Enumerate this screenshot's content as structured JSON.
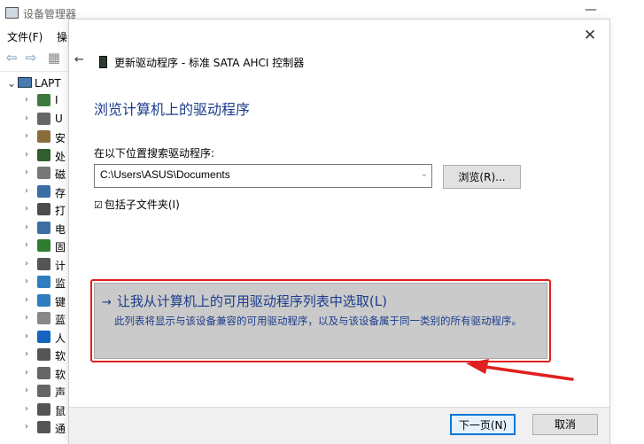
{
  "device_manager": {
    "title": "设备管理器",
    "menu": [
      "文件(F)",
      "操"
    ],
    "tree_root": "LAPT",
    "tree_items": [
      {
        "label": "I",
        "color": "#3d7a3d"
      },
      {
        "label": "U",
        "color": "#666666"
      },
      {
        "label": "安",
        "color": "#8a6d3b"
      },
      {
        "label": "处",
        "color": "#2f5f2f"
      },
      {
        "label": "磁",
        "color": "#777777"
      },
      {
        "label": "存",
        "color": "#3a6ea5"
      },
      {
        "label": "打",
        "color": "#4d4d4d"
      },
      {
        "label": "电",
        "color": "#3a6ea5"
      },
      {
        "label": "固",
        "color": "#2e7d32"
      },
      {
        "label": "计",
        "color": "#555555"
      },
      {
        "label": "监",
        "color": "#2f7dc0"
      },
      {
        "label": "键",
        "color": "#2f7dc0"
      },
      {
        "label": "蓝",
        "color": "#888888"
      },
      {
        "label": "人",
        "color": "#1565c0"
      },
      {
        "label": "软",
        "color": "#555555"
      },
      {
        "label": "软",
        "color": "#666666"
      },
      {
        "label": "声",
        "color": "#666666"
      },
      {
        "label": "鼠",
        "color": "#555555"
      },
      {
        "label": "通",
        "color": "#555555"
      }
    ]
  },
  "dialog": {
    "title": "更新驱动程序 - 标准 SATA AHCI 控制器",
    "heading": "浏览计算机上的驱动程序",
    "search_label": "在以下位置搜索驱动程序:",
    "path_value": "C:\\Users\\ASUS\\Documents",
    "browse_label": "浏览(R)...",
    "include_subfolders_label": "包括子文件夹(I)",
    "include_subfolders_checked": true,
    "pick_option_title": "让我从计算机上的可用驱动程序列表中选取(L)",
    "pick_option_desc": "此列表将显示与该设备兼容的可用驱动程序，以及与该设备属于同一类别的所有驱动程序。",
    "next_label": "下一页(N)",
    "cancel_label": "取消",
    "highlight_color": "#e02020",
    "link_color": "#1c3c8c"
  }
}
